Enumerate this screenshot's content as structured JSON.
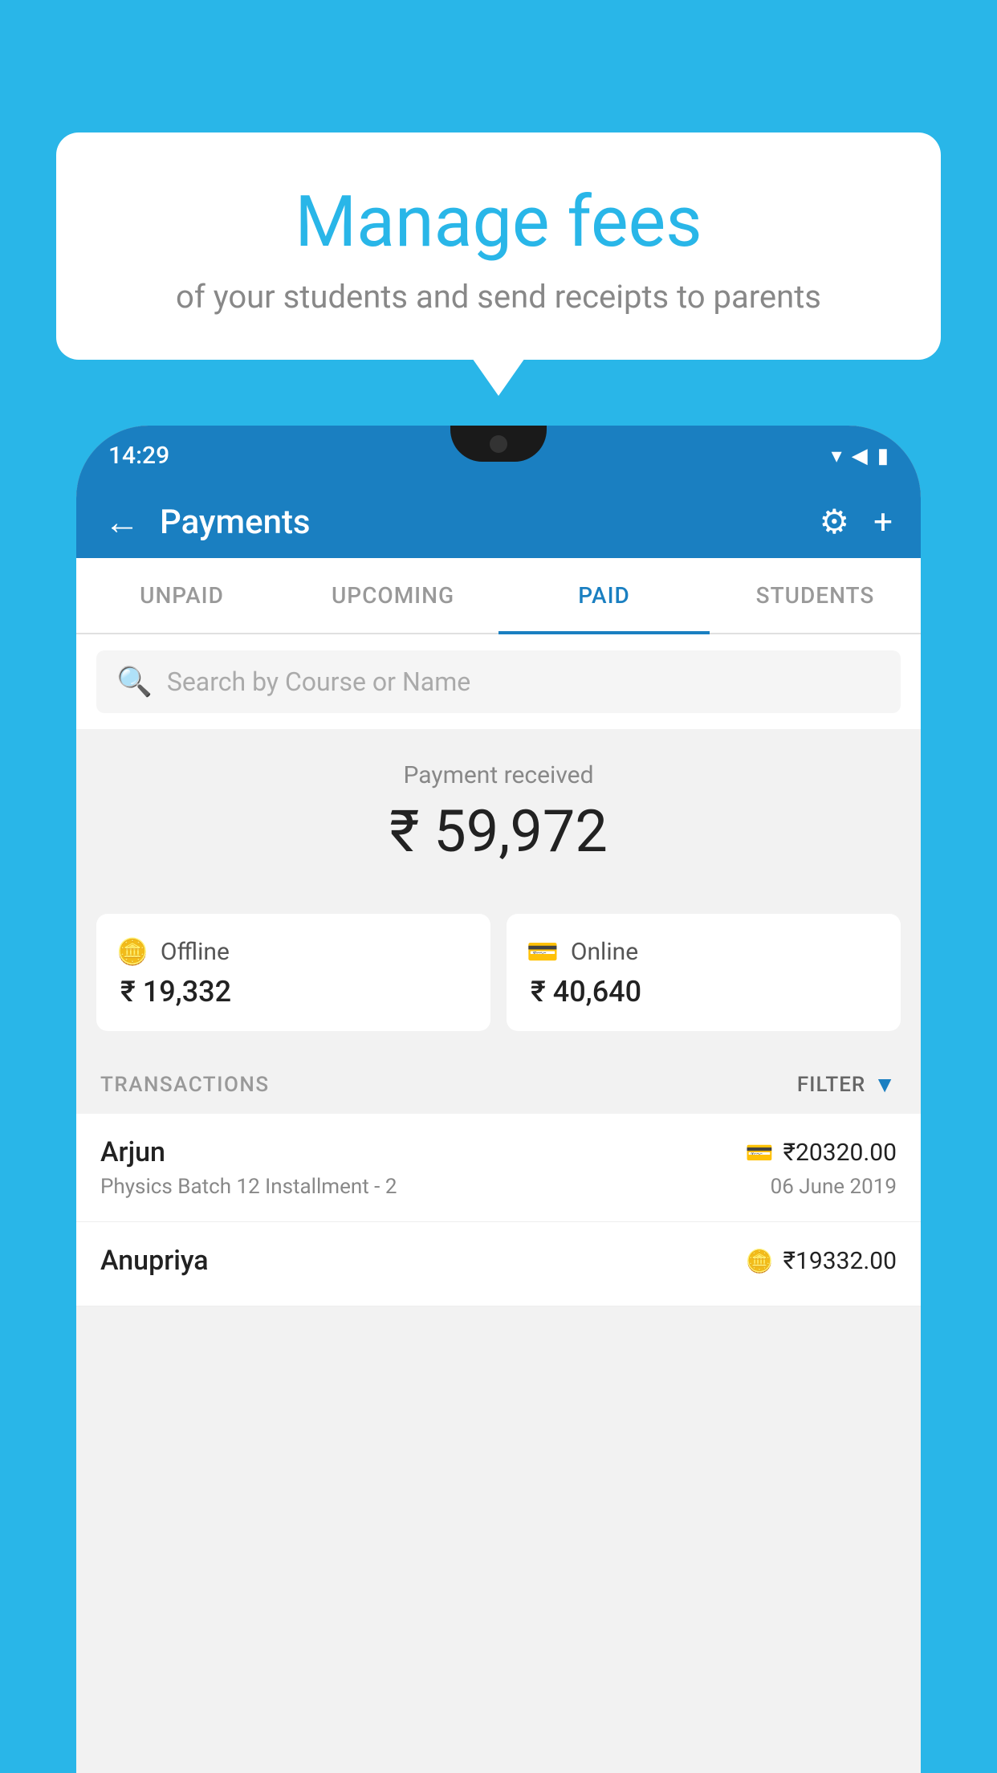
{
  "background": {
    "color": "#29B6E8"
  },
  "bubble": {
    "title": "Manage fees",
    "subtitle": "of your students and send receipts to parents"
  },
  "statusBar": {
    "time": "14:29",
    "icons": [
      "▾",
      "◀",
      "▮"
    ]
  },
  "header": {
    "title": "Payments",
    "back_label": "←",
    "settings_label": "⚙",
    "add_label": "+"
  },
  "tabs": [
    {
      "label": "UNPAID",
      "active": false
    },
    {
      "label": "UPCOMING",
      "active": false
    },
    {
      "label": "PAID",
      "active": true
    },
    {
      "label": "STUDENTS",
      "active": false
    }
  ],
  "search": {
    "placeholder": "Search by Course or Name"
  },
  "payment": {
    "received_label": "Payment received",
    "amount": "₹ 59,972",
    "offline": {
      "label": "Offline",
      "amount": "₹ 19,332",
      "icon": "💳"
    },
    "online": {
      "label": "Online",
      "amount": "₹ 40,640",
      "icon": "💳"
    }
  },
  "transactions": {
    "label": "TRANSACTIONS",
    "filter_label": "FILTER",
    "items": [
      {
        "name": "Arjun",
        "amount": "₹20320.00",
        "course": "Physics Batch 12 Installment - 2",
        "date": "06 June 2019",
        "payment_type": "online"
      },
      {
        "name": "Anupriya",
        "amount": "₹19332.00",
        "course": "",
        "date": "",
        "payment_type": "offline"
      }
    ]
  }
}
